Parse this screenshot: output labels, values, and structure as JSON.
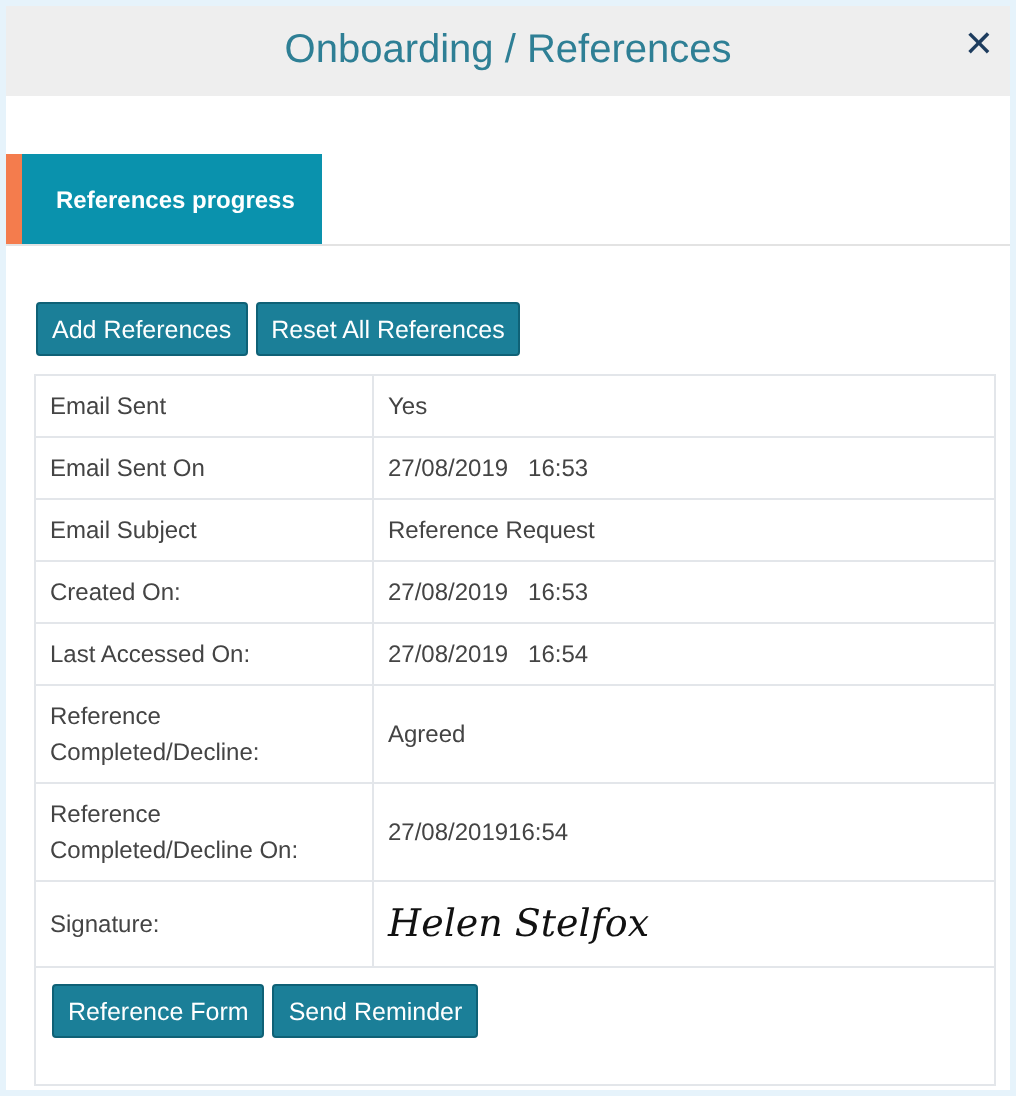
{
  "window": {
    "title": "Onboarding / References",
    "close": "✕"
  },
  "tabs": [
    {
      "label": "References progress",
      "selected": true
    }
  ],
  "actions": [
    "Add References",
    "Reset All References"
  ],
  "details": [
    {
      "kind": "text",
      "label": "Email Sent",
      "value": "Yes"
    },
    {
      "kind": "text",
      "label": "Email Sent On",
      "value": "27/08/2019   16:53"
    },
    {
      "kind": "text",
      "label": "Email Subject",
      "value": "Reference Request"
    },
    {
      "kind": "text",
      "label": "Created On:",
      "value": "27/08/2019   16:53"
    },
    {
      "kind": "text",
      "label": "Last Accessed On:",
      "value": "27/08/2019   16:54"
    },
    {
      "kind": "text",
      "label": "Reference Completed/Decline:",
      "value": "Agreed"
    },
    {
      "kind": "text",
      "label": "Reference Completed/Decline On:",
      "value": "27/08/201916:54"
    },
    {
      "kind": "signature",
      "label": "Signature:",
      "value": "Helen Stelfox"
    }
  ],
  "footer_buttons": [
    "Reference Form",
    "Send Reminder"
  ]
}
